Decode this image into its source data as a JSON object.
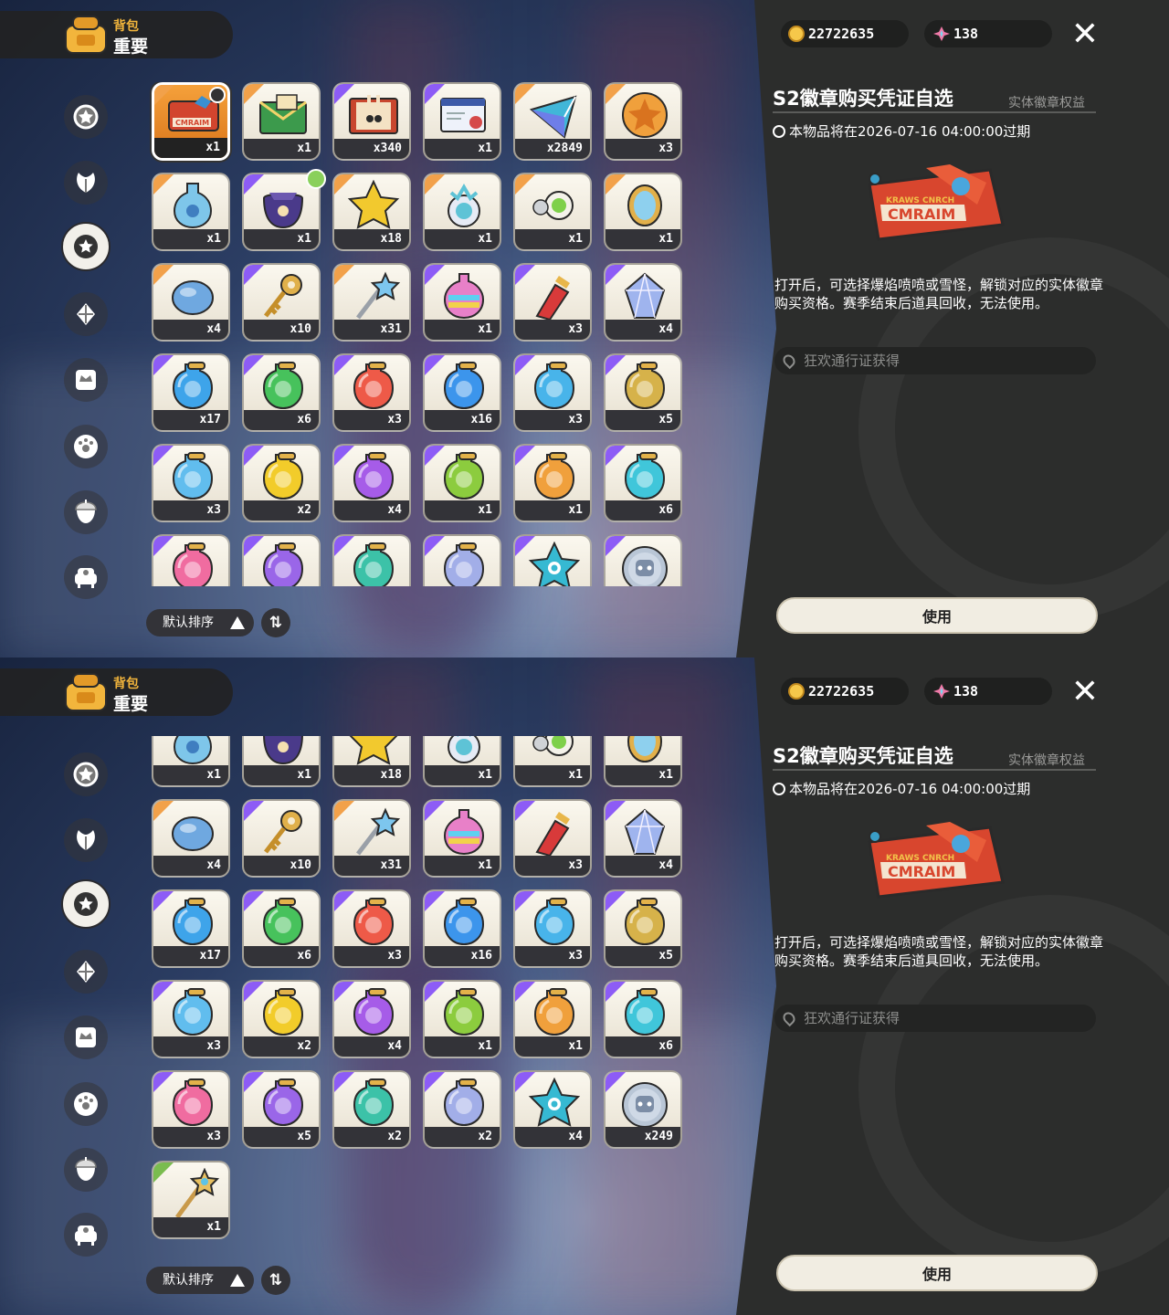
{
  "header": {
    "small": "背包",
    "big": "重要"
  },
  "currency": {
    "coins": "22722635",
    "gems": "138"
  },
  "detail": {
    "title": "S2徽章购买凭证自选",
    "subtitle": "实体徽章权益",
    "expiry": "本物品将在2026-07-16 04:00:00过期",
    "ticket_text": "CMRAIM",
    "ticket_small": "KRAWS CNRCH",
    "description": "打开后，可选择爆焰喷喷或雪怪，解锁对应的实体徽章购买资格。赛季结束后道具回收，无法使用。",
    "source": "狂欢通行证获得",
    "use_button": "使用"
  },
  "sort": {
    "label": "默认排序",
    "order_glyph": "⇅"
  },
  "categories": [
    "star-badge",
    "leaf",
    "gear-star",
    "seed",
    "crown-card",
    "paw-ball",
    "acorn",
    "sofa"
  ],
  "active_category": 2,
  "items": [
    {
      "qty": "x1",
      "rarity": "orange",
      "kind": "ticket",
      "selected": true
    },
    {
      "qty": "x1",
      "rarity": "orange",
      "kind": "envelope"
    },
    {
      "qty": "x340",
      "rarity": "purple",
      "kind": "card"
    },
    {
      "qty": "x1",
      "rarity": "purple",
      "kind": "letter"
    },
    {
      "qty": "x2849",
      "rarity": "orange",
      "kind": "crystal"
    },
    {
      "qty": "x3",
      "rarity": "orange",
      "kind": "medal"
    },
    {
      "qty": "x1",
      "rarity": "orange",
      "kind": "bottle"
    },
    {
      "qty": "x1",
      "rarity": "purple",
      "kind": "pouch",
      "badge": true
    },
    {
      "qty": "x18",
      "rarity": "orange",
      "kind": "star"
    },
    {
      "qty": "x1",
      "rarity": "orange",
      "kind": "orb"
    },
    {
      "qty": "x1",
      "rarity": "orange",
      "kind": "charm"
    },
    {
      "qty": "x1",
      "rarity": "orange",
      "kind": "mirror"
    },
    {
      "qty": "x4",
      "rarity": "orange",
      "kind": "egg"
    },
    {
      "qty": "x10",
      "rarity": "purple",
      "kind": "key"
    },
    {
      "qty": "x31",
      "rarity": "orange",
      "kind": "wand"
    },
    {
      "qty": "x1",
      "rarity": "purple",
      "kind": "rainbow"
    },
    {
      "qty": "x3",
      "rarity": "purple",
      "kind": "redpotion"
    },
    {
      "qty": "x4",
      "rarity": "purple",
      "kind": "gem"
    },
    {
      "qty": "x17",
      "rarity": "purple",
      "kind": "pot",
      "color": "#3ea4ea"
    },
    {
      "qty": "x6",
      "rarity": "purple",
      "kind": "pot",
      "color": "#47c25c"
    },
    {
      "qty": "x3",
      "rarity": "purple",
      "kind": "pot",
      "color": "#ee5a48"
    },
    {
      "qty": "x16",
      "rarity": "purple",
      "kind": "pot",
      "color": "#3c95ec"
    },
    {
      "qty": "x3",
      "rarity": "purple",
      "kind": "pot",
      "color": "#48b4ea"
    },
    {
      "qty": "x5",
      "rarity": "purple",
      "kind": "pot",
      "color": "#d6b24a"
    },
    {
      "qty": "x3",
      "rarity": "purple",
      "kind": "pot",
      "color": "#61bdee"
    },
    {
      "qty": "x2",
      "rarity": "purple",
      "kind": "pot",
      "color": "#f2cc2a"
    },
    {
      "qty": "x4",
      "rarity": "purple",
      "kind": "pot",
      "color": "#a65ce8"
    },
    {
      "qty": "x1",
      "rarity": "purple",
      "kind": "pot",
      "color": "#8ccc3e"
    },
    {
      "qty": "x1",
      "rarity": "purple",
      "kind": "pot",
      "color": "#f0a03c"
    },
    {
      "qty": "x6",
      "rarity": "purple",
      "kind": "pot",
      "color": "#40c6da"
    },
    {
      "qty": "x3",
      "rarity": "purple",
      "kind": "pot",
      "color": "#f06ca0"
    },
    {
      "qty": "x5",
      "rarity": "purple",
      "kind": "pot",
      "color": "#9a66e8"
    },
    {
      "qty": "x2",
      "rarity": "purple",
      "kind": "pot",
      "color": "#3cc2a8"
    },
    {
      "qty": "x2",
      "rarity": "purple",
      "kind": "pot",
      "color": "#a2aee8"
    },
    {
      "qty": "x4",
      "rarity": "purple",
      "kind": "starcyan"
    },
    {
      "qty": "x249",
      "rarity": "purple",
      "kind": "coin"
    },
    {
      "qty": "x1",
      "rarity": "green",
      "kind": "staff"
    }
  ]
}
